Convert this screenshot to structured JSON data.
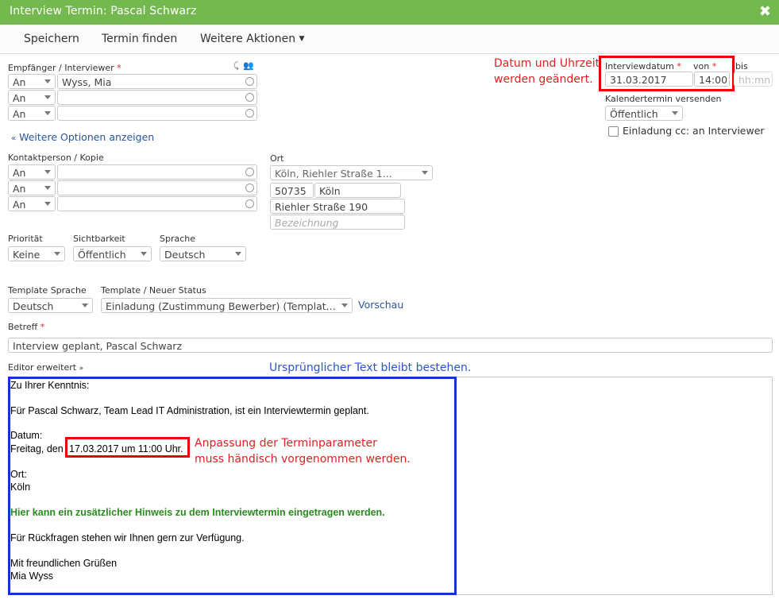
{
  "window": {
    "title": "Interview Termin: Pascal Schwarz",
    "close_icon": "close-icon"
  },
  "toolbar": {
    "save": "Speichern",
    "find": "Termin finden",
    "more": "Weitere Aktionen"
  },
  "recipients": {
    "label": "Empfänger / Interviewer",
    "rows": [
      {
        "type": "An",
        "value": "Wyss, Mia"
      },
      {
        "type": "An",
        "value": ""
      },
      {
        "type": "An",
        "value": ""
      }
    ],
    "more_options": "Weitere Optionen anzeigen"
  },
  "contact": {
    "label": "Kontaktperson / Kopie",
    "rows": [
      {
        "type": "An"
      },
      {
        "type": "An"
      },
      {
        "type": "An"
      }
    ]
  },
  "location": {
    "label": "Ort",
    "selected": "Köln, Riehler Straße 1...",
    "zip": "50735",
    "city": "Köln",
    "street": "Riehler Straße 190",
    "designation_placeholder": "Bezeichnung"
  },
  "priority": {
    "label": "Priorität",
    "value": "Keine"
  },
  "visibility": {
    "label": "Sichtbarkeit",
    "value": "Öffentlich"
  },
  "language": {
    "label": "Sprache",
    "value": "Deutsch"
  },
  "template_language": {
    "label": "Template Sprache",
    "value": "Deutsch"
  },
  "template": {
    "label": "Template / Neuer Status",
    "value": "Einladung (Zustimmung Bewerber) (Templat...",
    "preview": "Vorschau"
  },
  "subject": {
    "label": "Betreff",
    "value": "Interview geplant, Pascal  Schwarz"
  },
  "editor": {
    "label": "Editor erweitert",
    "lines": [
      "Zu Ihrer Kenntnis:",
      "Für Pascal Schwarz, Team Lead IT Administration, ist ein Interviewtermin geplant.",
      "Datum:",
      "Freitag, den",
      "17.03.2017 um 11:00 Uhr.",
      "Ort:",
      "Köln",
      "Hier kann ein zusätzlicher Hinweis zu dem Interviewtermin eingetragen werden.",
      "Für Rückfragen stehen wir Ihnen gern zur Verfügung.",
      "Mit freundlichen Grüßen",
      "Mia Wyss"
    ]
  },
  "interview": {
    "date_label": "Interviewdatum",
    "date": "31.03.2017",
    "from_label": "von",
    "from": "14:00",
    "to_label": "bis",
    "to_placeholder": "hh:mn",
    "calendar_label": "Kalendertermin versenden",
    "calendar_value": "Öffentlich",
    "cc_label": "Einladung cc: an Interviewer"
  },
  "annotations": {
    "datetime_changed_1": "Datum und Uhrzeit",
    "datetime_changed_2": "werden geändert.",
    "original_text": "Ursprünglicher Text bleibt bestehen.",
    "adjust_1": "Anpassung der Terminparameter",
    "adjust_2": "muss händisch vorgenommen werden."
  },
  "colors": {
    "titlebar": "#74b94f",
    "annotation_red": "#e02020",
    "annotation_blue": "#2b55c9",
    "editor_border": "#1333d6",
    "green_text": "#2a8a1f"
  }
}
